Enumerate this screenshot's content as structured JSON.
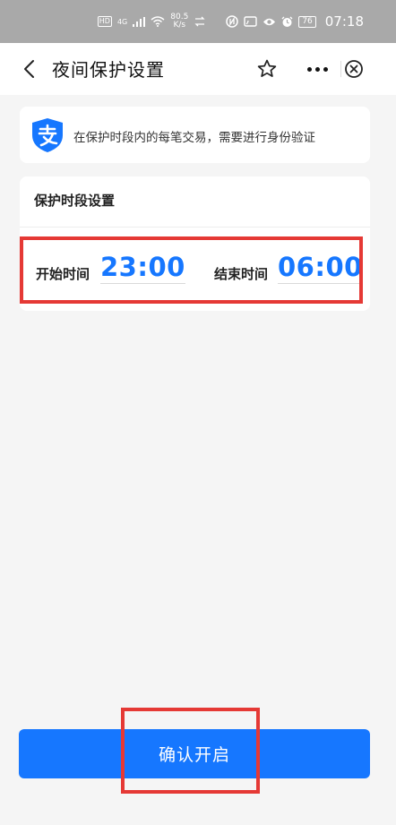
{
  "status_bar": {
    "hd": "HD",
    "network": "4G",
    "speed_value": "80.5",
    "speed_unit": "K/s",
    "battery": "76",
    "time": "07:18"
  },
  "nav": {
    "title": "夜间保护设置",
    "icons": [
      "back-icon",
      "star-icon",
      "more-icon",
      "close-icon"
    ]
  },
  "tip": {
    "text": "在保护时段内的每笔交易，需要进行身份验证",
    "icon": "alipay-icon"
  },
  "period": {
    "title": "保护时段设置",
    "start_label": "开始时间",
    "start_value": "23:00",
    "end_label": "结束时间",
    "end_value": "06:00"
  },
  "confirm_button": {
    "label": "确认开启"
  },
  "colors": {
    "accent": "#1677ff",
    "highlight": "#e53935",
    "status_bar": "#a9a9a9",
    "background": "#f5f5f5"
  }
}
